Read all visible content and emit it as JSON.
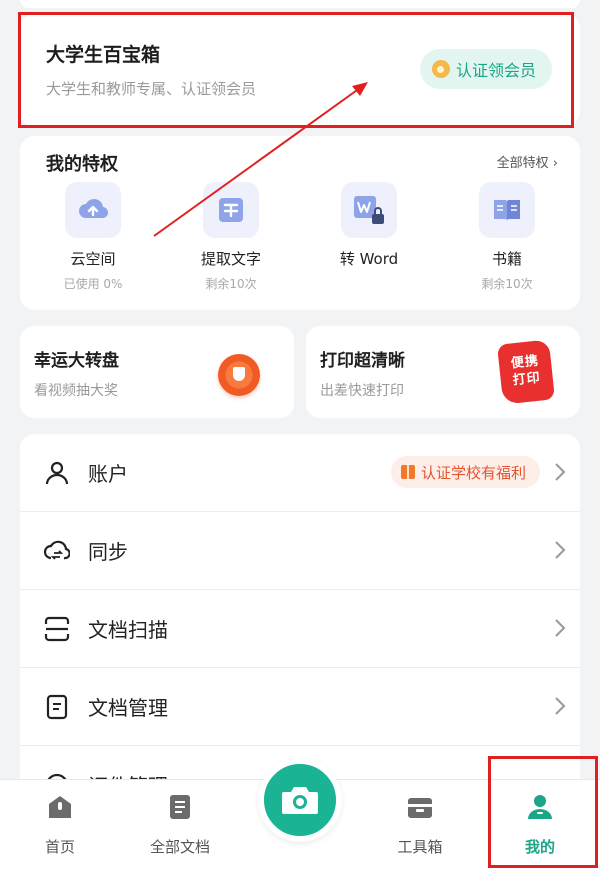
{
  "student_box": {
    "title": "大学生百宝箱",
    "subtitle": "大学生和教师专属、认证领会员",
    "certify_label": "认证领会员"
  },
  "privileges": {
    "title": "我的特权",
    "all_label": "全部特权 ›",
    "items": [
      {
        "label": "云空间",
        "sub": "已使用 0%",
        "icon": "cloud-upload-icon"
      },
      {
        "label": "提取文字",
        "sub": "剩余10次",
        "icon": "text-extract-icon"
      },
      {
        "label": "转 Word",
        "sub": "",
        "icon": "word-convert-icon"
      },
      {
        "label": "书籍",
        "sub": "剩余10次",
        "icon": "book-icon"
      }
    ]
  },
  "promos": [
    {
      "title": "幸运大转盘",
      "sub": "看视频抽大奖"
    },
    {
      "title": "打印超清晰",
      "sub": "出差快速打印",
      "badge": "便携\n打印"
    }
  ],
  "menu": [
    {
      "label": "账户",
      "badge": "认证学校有福利",
      "icon": "user-icon"
    },
    {
      "label": "同步",
      "icon": "cloud-sync-icon"
    },
    {
      "label": "文档扫描",
      "icon": "scan-icon"
    },
    {
      "label": "文档管理",
      "icon": "document-icon"
    },
    {
      "label": "证件管理",
      "icon": "id-card-icon"
    }
  ],
  "nav": {
    "items": [
      {
        "label": "首页",
        "icon": "home-icon"
      },
      {
        "label": "全部文档",
        "icon": "documents-icon"
      },
      {
        "label": "工具箱",
        "icon": "toolbox-icon"
      },
      {
        "label": "我的",
        "icon": "profile-icon",
        "active": true
      }
    ],
    "camera_icon": "camera-icon"
  },
  "colors": {
    "accent": "#1aa687",
    "highlight_red": "#e02020"
  }
}
